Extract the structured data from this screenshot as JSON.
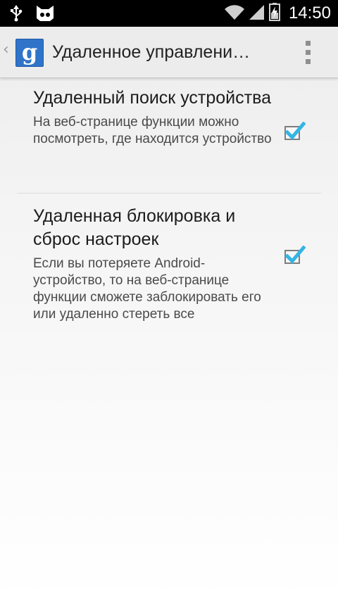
{
  "status_bar": {
    "time": "14:50",
    "icons": [
      "usb-icon",
      "cyanogenmod-icon",
      "wifi-icon",
      "cell-signal-icon",
      "battery-charging-icon"
    ]
  },
  "action_bar": {
    "up_indicator": "‹",
    "app_icon_letter": "g",
    "title": "Удаленное управлени…",
    "overflow_icon": "overflow-menu-icon"
  },
  "preferences": [
    {
      "title": "Удаленный поиск устройства",
      "summary": "На веб-странице функции можно посмотреть, где находится устройство",
      "checked": true
    },
    {
      "title": "Удаленная блокировка и сброс настроек",
      "summary": "Если вы потеряете Android-устройство, то на веб-странице функции сможете заблокировать его или удаленно стереть все",
      "checked": true
    }
  ],
  "colors": {
    "check_accent": "#33b5e5",
    "app_icon_bg": "#2f74c9",
    "status_bar_bg": "#000000",
    "action_bar_bg": "#ececec"
  }
}
